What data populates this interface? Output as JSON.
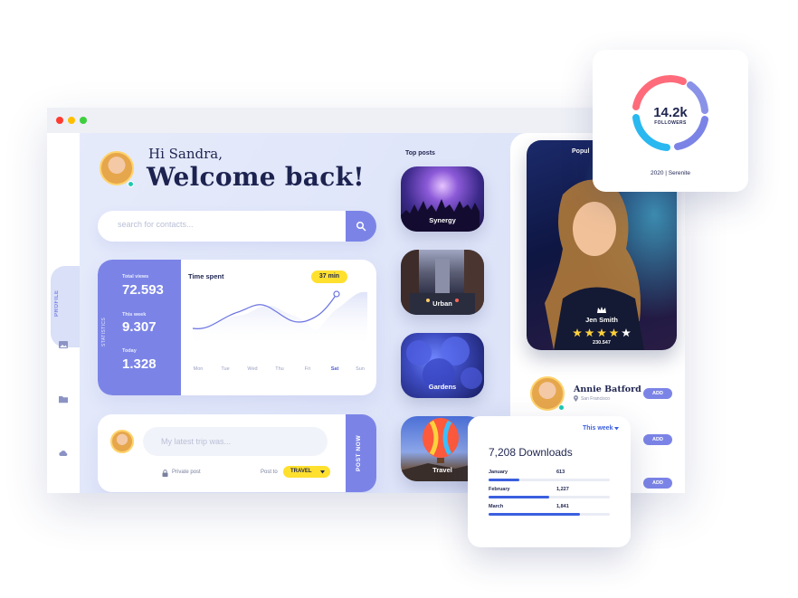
{
  "greeting": {
    "hi": "Hi Sandra,",
    "welcome": "Welcome back!"
  },
  "search": {
    "placeholder": "search for contacts..."
  },
  "sidebar": {
    "profile_label": "PROFILE",
    "icons": [
      "image-icon",
      "folder-icon",
      "cloud-icon"
    ]
  },
  "stats": {
    "vertical_label": "STATISTICS",
    "items": [
      {
        "label": "Total views",
        "value": "72.593"
      },
      {
        "label": "This week",
        "value": "9.307"
      },
      {
        "label": "Today",
        "value": "1.328"
      }
    ],
    "chart_title": "Time spent",
    "badge": "37 min",
    "days": [
      "Mon",
      "Tue",
      "Wed",
      "Thu",
      "Fri",
      "Sat",
      "Sun"
    ],
    "active_day": "Sat"
  },
  "post": {
    "placeholder": "My latest trip was...",
    "private_label": "Private post",
    "post_to_label": "Post to",
    "category": "TRAVEL",
    "button": "POST NOW"
  },
  "top_posts": {
    "title": "Top posts",
    "items": [
      {
        "label": "Synergy"
      },
      {
        "label": "Urban"
      },
      {
        "label": "Gardens"
      },
      {
        "label": "Travel"
      }
    ]
  },
  "popular": {
    "title": "Popul",
    "name": "Jen Smith",
    "rating": 5,
    "count": "230.547"
  },
  "profile_row": {
    "name": "Annie Batford",
    "location": "San Francisco",
    "add_label": "ADD"
  },
  "followers": {
    "value": "14.2k",
    "label": "FOLLOWERS",
    "caption": "2020 | Serenite"
  },
  "downloads": {
    "period": "This week",
    "title": "7,208 Downloads",
    "items": [
      {
        "month": "January",
        "value": "613",
        "fraction": 0.25
      },
      {
        "month": "February",
        "value": "1,227",
        "fraction": 0.5
      },
      {
        "month": "March",
        "value": "1,841",
        "fraction": 0.75
      }
    ]
  },
  "colors": {
    "accent": "#7b84e6",
    "highlight": "#ffe02e",
    "online": "#1cc9b3",
    "link": "#3b5fe0"
  }
}
